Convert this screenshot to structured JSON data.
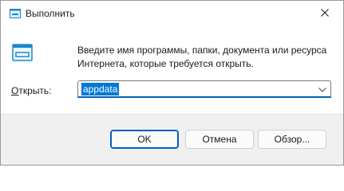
{
  "window": {
    "title": "Выполнить",
    "close_glyph": "✕"
  },
  "icons": {
    "app": "run-icon",
    "content": "run-icon",
    "close": "close-icon",
    "dropdown": "chevron-down-icon"
  },
  "content": {
    "description": "Введите имя программы, папки, документа или ресурса Интернета, которые требуется открыть.",
    "open_label_accel": "О",
    "open_label_rest": "ткрыть:",
    "input_value": "appdata"
  },
  "buttons": {
    "ok": "OK",
    "cancel": "Отмена",
    "browse": "Обзор..."
  },
  "colors": {
    "accent": "#005fb8",
    "selection": "#0078d4",
    "footer_bg": "#f0f0f0"
  }
}
